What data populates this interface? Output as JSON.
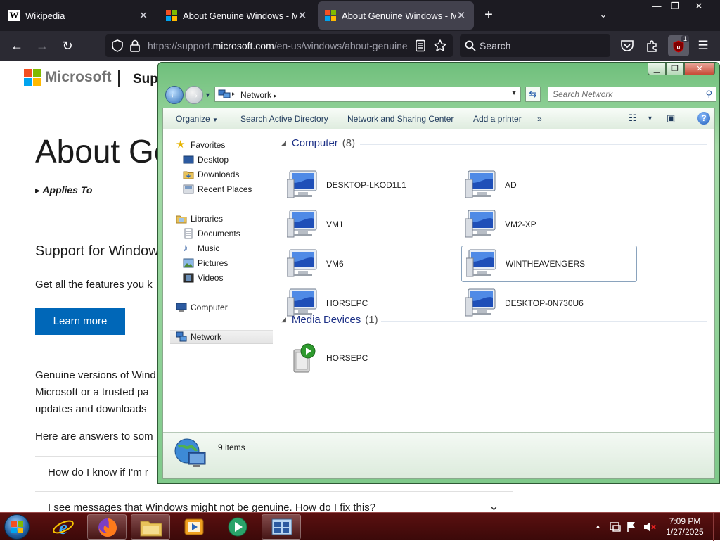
{
  "browser": {
    "tabs": [
      {
        "title": "Wikipedia",
        "favicon": "wikipedia-icon",
        "active": false
      },
      {
        "title": "About Genuine Windows - Microsoft",
        "favicon": "microsoft-icon",
        "active": false
      },
      {
        "title": "About Genuine Windows - Microsoft",
        "favicon": "microsoft-icon",
        "active": true
      }
    ],
    "url_prefix": "https://support.",
    "url_domain": "microsoft.com",
    "url_rest": "/en-us/windows/about-genuine",
    "search_placeholder": "Search",
    "extension_badge": "1",
    "window_controls": {
      "minimize": "—",
      "restore": "❐",
      "close": "✕"
    }
  },
  "ms_page": {
    "brand": "Microsoft",
    "support": "Supp",
    "title": "About Ge",
    "applies_to": "Applies To",
    "section_heading": "Support for Window",
    "feature_text": "Get all the features you k",
    "learn_more": "Learn more",
    "para_lines": [
      "Genuine versions of Wind",
      "Microsoft or a trusted pa",
      "updates and downloads"
    ],
    "answers": "Here are answers to som",
    "faq": [
      "How do I know if I'm r",
      "I see messages that Windows might not be genuine. How do I fix this?"
    ]
  },
  "explorer": {
    "address": "Network",
    "search_placeholder": "Search Network",
    "commands": [
      "Organize",
      "Search Active Directory",
      "Network and Sharing Center",
      "Add a printer"
    ],
    "more": "»",
    "nav": {
      "favorites": "Favorites",
      "favorites_items": [
        "Desktop",
        "Downloads",
        "Recent Places"
      ],
      "libraries": "Libraries",
      "libraries_items": [
        "Documents",
        "Music",
        "Pictures",
        "Videos"
      ],
      "computer": "Computer",
      "network": "Network"
    },
    "groups": [
      {
        "name": "Computer",
        "count": "(8)",
        "items": [
          "DESKTOP-LKOD1L1",
          "AD",
          "VM1",
          "VM2-XP",
          "VM6",
          "WINTHEAVENGERS",
          "HORSEPC",
          "DESKTOP-0N730U6"
        ]
      },
      {
        "name": "Media Devices",
        "count": "(1)",
        "items": [
          "HORSEPC"
        ]
      }
    ],
    "status": "9 items"
  },
  "taskbar": {
    "time": "7:09 PM",
    "date": "1/27/2025",
    "tray_arrow": "▲"
  },
  "colors": {
    "accent_blue": "#0067b8",
    "win7_green_frame": "#7fc98a",
    "taskbar_red": "#4a0d0d",
    "firefox_dark": "#1c1b22"
  }
}
